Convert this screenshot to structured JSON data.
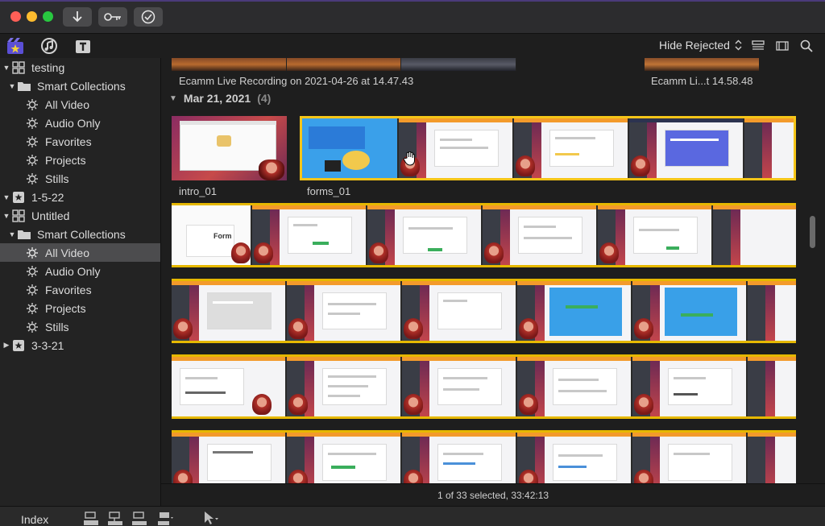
{
  "toolbar": {
    "import_icon": "arrow-down-icon",
    "keywords_icon": "key-icon",
    "check_icon": "checkmark-circle-icon",
    "filter_label": "Hide Rejected"
  },
  "sidebar": {
    "items": [
      {
        "label": "testing",
        "level": 0,
        "type": "library"
      },
      {
        "label": "Smart Collections",
        "level": 1,
        "type": "folder"
      },
      {
        "label": "All Video",
        "level": 2,
        "type": "smart"
      },
      {
        "label": "Audio Only",
        "level": 2,
        "type": "smart"
      },
      {
        "label": "Favorites",
        "level": 2,
        "type": "smart"
      },
      {
        "label": "Projects",
        "level": 2,
        "type": "smart"
      },
      {
        "label": "Stills",
        "level": 2,
        "type": "smart"
      },
      {
        "label": "1-5-22",
        "level": 0,
        "type": "event"
      },
      {
        "label": "Untitled",
        "level": 0,
        "type": "library"
      },
      {
        "label": "Smart Collections",
        "level": 1,
        "type": "folder"
      },
      {
        "label": "All Video",
        "level": 2,
        "type": "smart",
        "selected": true
      },
      {
        "label": "Audio Only",
        "level": 2,
        "type": "smart"
      },
      {
        "label": "Favorites",
        "level": 2,
        "type": "smart"
      },
      {
        "label": "Projects",
        "level": 2,
        "type": "smart"
      },
      {
        "label": "Stills",
        "level": 2,
        "type": "smart"
      },
      {
        "label": "3-3-21",
        "level": 0,
        "type": "event"
      }
    ]
  },
  "browser": {
    "caption_1": "Ecamm Live Recording on 2021-04-26 at 14.47.43",
    "caption_2": "Ecamm Li...t 14.58.48",
    "date_group": "Mar 21, 2021",
    "date_count": "(4)",
    "clip_1": "intro_01",
    "clip_2": "forms_01",
    "form_label": "Form"
  },
  "status": {
    "text": "1 of 33 selected, 33:42:13"
  },
  "bottom": {
    "index_label": "Index"
  },
  "colors": {
    "selection": "#f5c518",
    "accent_purple": "#5b4fd6",
    "sidebar_selected": "#4c4c4e"
  }
}
